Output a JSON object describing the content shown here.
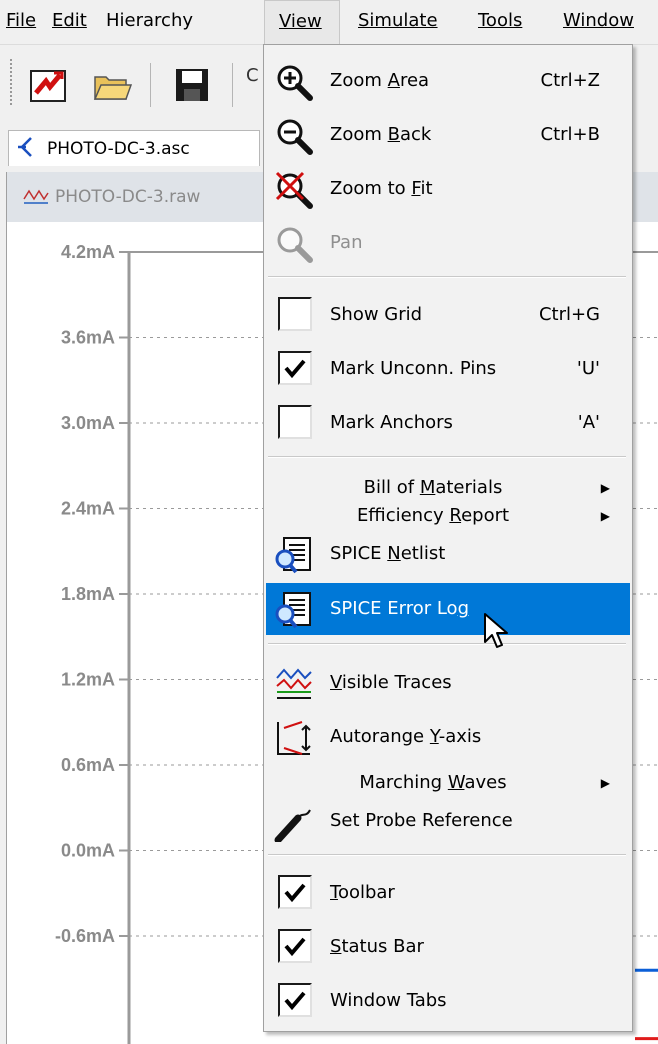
{
  "menubar": {
    "items": [
      {
        "label": "File"
      },
      {
        "label": "Edit"
      },
      {
        "label": "Hierarchy"
      },
      {
        "label": "View"
      },
      {
        "label": "Simulate"
      },
      {
        "label": "Tools"
      },
      {
        "label": "Window"
      }
    ]
  },
  "toolbar": {
    "buttons": [
      {
        "icon": "new-schematic-icon"
      },
      {
        "icon": "open-folder-icon"
      },
      {
        "icon": "save-disk-icon"
      }
    ],
    "cut_off_label": "C"
  },
  "tabs": [
    {
      "label": "PHOTO-DC-3.asc",
      "icon": "schematic-icon"
    }
  ],
  "waveform": {
    "title": "PHOTO-DC-3.raw",
    "grid": true
  },
  "chart_data": {
    "type": "line",
    "y_ticks": [
      "4.2mA",
      "3.6mA",
      "3.0mA",
      "2.4mA",
      "1.8mA",
      "1.2mA",
      "0.6mA",
      "0.0mA",
      "-0.6mA"
    ],
    "ylim": [
      -0.6,
      4.2
    ],
    "series": [
      {
        "color": "#0b5fd7",
        "values": []
      },
      {
        "color": "#e01b1b",
        "values": []
      }
    ]
  },
  "view_menu": {
    "items": [
      {
        "label": "Zoom Area",
        "mnemonic_prefix": "Zoom ",
        "mnemonic": "A",
        "mnemonic_suffix": "rea",
        "shortcut": "Ctrl+Z",
        "icon": "zoom-in-icon"
      },
      {
        "label": "Zoom Back",
        "mnemonic_prefix": "Zoom ",
        "mnemonic": "B",
        "mnemonic_suffix": "ack",
        "shortcut": "Ctrl+B",
        "icon": "zoom-out-icon"
      },
      {
        "label": "Zoom to Fit",
        "mnemonic_prefix": "Zoom to ",
        "mnemonic": "F",
        "mnemonic_suffix": "it",
        "icon": "zoom-fit-icon"
      },
      {
        "label": "Pan",
        "disabled": true,
        "icon": "pan-magnifier-icon"
      },
      {
        "label": "Show Grid",
        "shortcut": "Ctrl+G",
        "checked": false
      },
      {
        "label": "Mark Unconn. Pins",
        "shortcut": "'U'",
        "checked": true
      },
      {
        "label": "Mark Anchors",
        "shortcut": "'A'",
        "checked": false
      },
      {
        "label": "Bill of Materials",
        "mnemonic_prefix": "Bill of ",
        "mnemonic": "M",
        "mnemonic_suffix": "aterials",
        "submenu": true
      },
      {
        "label": "Efficiency Report",
        "mnemonic_prefix": "Efficiency ",
        "mnemonic": "R",
        "mnemonic_suffix": "eport",
        "submenu": true
      },
      {
        "label": "SPICE Netlist",
        "mnemonic_prefix": "SPICE ",
        "mnemonic": "N",
        "mnemonic_suffix": "etlist",
        "icon": "netlist-icon"
      },
      {
        "label": "SPICE Error Log",
        "mnemonic_prefix": "SPICE Error Lo",
        "mnemonic": "g",
        "mnemonic_suffix": "",
        "icon": "error-log-icon",
        "highlighted": true
      },
      {
        "label": "Visible Traces",
        "mnemonic_prefix": "",
        "mnemonic": "V",
        "mnemonic_suffix": "isible Traces",
        "icon": "visible-traces-icon"
      },
      {
        "label": "Autorange Y-axis",
        "mnemonic_prefix": "Autorange ",
        "mnemonic": "Y",
        "mnemonic_suffix": "-axis",
        "icon": "autorange-icon"
      },
      {
        "label": "Marching Waves",
        "mnemonic_prefix": "Marching ",
        "mnemonic": "W",
        "mnemonic_suffix": "aves",
        "submenu": true
      },
      {
        "label": "Set Probe Reference",
        "icon": "probe-icon"
      },
      {
        "label": "Toolbar",
        "mnemonic_prefix": "",
        "mnemonic": "T",
        "mnemonic_suffix": "oolbar",
        "checked": true
      },
      {
        "label": "Status Bar",
        "mnemonic_prefix": "",
        "mnemonic": "S",
        "mnemonic_suffix": "tatus Bar",
        "checked": true
      },
      {
        "label": "Window Tabs",
        "checked": true
      }
    ]
  },
  "colors": {
    "highlight": "#0078d7",
    "menu_bg": "#f2f2f2",
    "axis_text": "#8a8a8a",
    "grid": "#9a9a9a"
  }
}
